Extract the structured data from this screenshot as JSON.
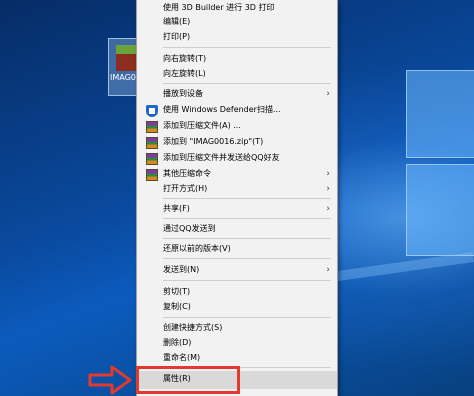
{
  "desktop_icon": {
    "label": "IMAG0016",
    "icon": "image-thumbnail-icon"
  },
  "menu": {
    "items": [
      {
        "label": "使用 3D Builder 进行 3D 打印",
        "top": 0
      },
      {
        "label": "编辑(E)"
      },
      {
        "label": "打印(P)"
      },
      {
        "label": "向右旋转(T)"
      },
      {
        "label": "向左旋转(L)"
      },
      {
        "label": "播放到设备",
        "submenu": true
      },
      {
        "label": "使用 Windows Defender扫描...",
        "icon": "windows-defender-icon"
      },
      {
        "label": "添加到压缩文件(A) ...",
        "icon": "winrar-icon"
      },
      {
        "label": "添加到 \"IMAG0016.zip\"(T)",
        "icon": "winrar-icon"
      },
      {
        "label": "添加到压缩文件并发送给QQ好友",
        "icon": "winrar-icon"
      },
      {
        "label": "其他压缩命令",
        "icon": "winrar-icon",
        "submenu": true
      },
      {
        "label": "打开方式(H)",
        "submenu": true
      },
      {
        "label": "共享(F)",
        "submenu": true
      },
      {
        "label": "通过QQ发送到"
      },
      {
        "label": "还原以前的版本(V)"
      },
      {
        "label": "发送到(N)",
        "submenu": true
      },
      {
        "label": "剪切(T)"
      },
      {
        "label": "复制(C)"
      },
      {
        "label": "创建快捷方式(S)"
      },
      {
        "label": "删除(D)"
      },
      {
        "label": "重命名(M)"
      },
      {
        "label": "属性(R)"
      }
    ]
  },
  "annotation": {
    "highlight_color": "#e23b2e",
    "target": "属性(R)"
  }
}
